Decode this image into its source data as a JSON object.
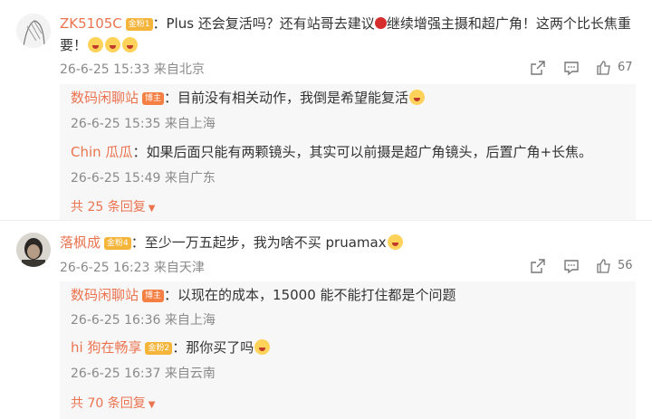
{
  "comments": [
    {
      "user": "ZK5105C",
      "badge": "金粉1",
      "text_a": "：Plus 还会复活吗？还有站哥去建议",
      "text_b": "继续增强主摄和超广角！这两个比长焦重",
      "text_c": "要！",
      "time": "26-6-25 15:33 来自北京",
      "likes": "67",
      "replies": [
        {
          "user": "数码闲聊站",
          "badge": "博主",
          "text": "：目前没有相关动作，我倒是希望能复活",
          "time": "26-6-25 15:35 来自上海"
        },
        {
          "user": "Chin 瓜瓜",
          "badge": "",
          "text": "：如果后面只能有两颗镜头，其实可以前摄是超广角镜头，后置广角+长焦。",
          "time": "26-6-25 15:49 来自广东"
        }
      ],
      "more": "共 25 条回复"
    },
    {
      "user": "落枫成",
      "badge": "金粉4",
      "text_a": "：至少一万五起步，我为啥不买 pruamax",
      "time": "26-6-25 16:23 来自天津",
      "likes": "56",
      "replies": [
        {
          "user": "数码闲聊站",
          "badge": "博主",
          "text": "：以现在的成本，15000 能不能打住都是个问题",
          "time": "26-6-25 16:36 来自上海"
        },
        {
          "user": "hi 狗在畅享",
          "badge": "金粉2",
          "text": "：那你买了吗",
          "time": "26-6-25 16:37 来自云南"
        }
      ],
      "more": "共 70 条回复"
    }
  ],
  "colors": {
    "username": "#eb7350",
    "fan_badge": "#f5b43a",
    "blogger_badge": "#f57e42",
    "meta": "#8a8a8a"
  }
}
